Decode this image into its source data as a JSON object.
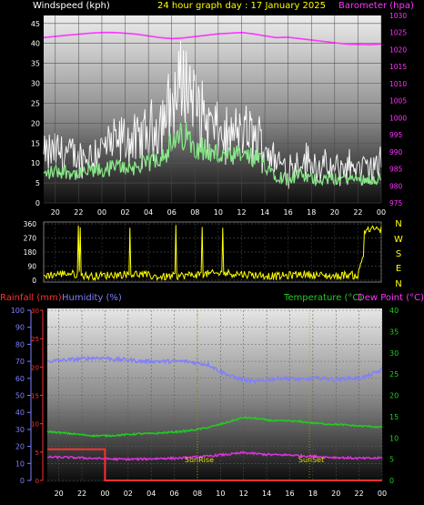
{
  "header": {
    "left_label": "Windspeed (kph)",
    "center_label": "24 hour graph day : 17 January 2025",
    "right_label": "Barometer (hpa)"
  },
  "colors": {
    "wind": "#ffffff",
    "gust": "#cccccc",
    "avg": "#88e888",
    "baro": "#ff33ff",
    "dir": "#ffff00",
    "rain": "#ff3030",
    "humidity": "#7f7fff",
    "temp": "#22cc22",
    "dew": "#dd33dd",
    "sun_marker": "#aaaa00"
  },
  "x_axis_ticks": [
    "20",
    "22",
    "00",
    "02",
    "04",
    "06",
    "08",
    "10",
    "12",
    "14",
    "16",
    "18",
    "20",
    "22",
    "00"
  ],
  "bottom_panel": {
    "rain_label": "Rainfall (mm)",
    "humidity_label": "Humidity (%)",
    "temp_label": "Temperature (°C)",
    "dew_label": "Dew Point (°C)",
    "sunrise_label": "SunRise",
    "sunset_label": "SunSet"
  },
  "direction_labels": [
    "N",
    "W",
    "S",
    "E",
    "N"
  ],
  "chart_data": [
    {
      "type": "line",
      "name": "wind-barometer",
      "title": "24 hour graph day : 17 January 2025",
      "x_range_hours": [
        -5,
        24
      ],
      "y_left": {
        "label": "Windspeed (kph)",
        "ticks": [
          0,
          5,
          10,
          15,
          20,
          25,
          30,
          35,
          40,
          45
        ],
        "ylim": [
          0,
          47
        ]
      },
      "y_right": {
        "label": "Barometer (hpa)",
        "ticks": [
          975,
          980,
          985,
          990,
          995,
          1000,
          1005,
          1010,
          1015,
          1020,
          1025,
          1030
        ],
        "ylim": [
          975,
          1030
        ]
      },
      "series": [
        {
          "name": "Barometer",
          "axis": "right",
          "x": [
            -5,
            -3,
            -1,
            0,
            1,
            2,
            3,
            4,
            5,
            6,
            7,
            8,
            9,
            10,
            11,
            12,
            13,
            14,
            15,
            16,
            17,
            18,
            19,
            20,
            21,
            22,
            23,
            24
          ],
          "y": [
            1023.5,
            1024.2,
            1024.8,
            1025.0,
            1025.0,
            1024.8,
            1024.5,
            1024.0,
            1023.5,
            1023.2,
            1023.4,
            1023.8,
            1024.2,
            1024.6,
            1024.8,
            1025.0,
            1024.6,
            1024.0,
            1023.5,
            1023.6,
            1023.2,
            1022.8,
            1022.4,
            1022.0,
            1021.6,
            1021.5,
            1021.4,
            1021.6
          ]
        },
        {
          "name": "Wind gust",
          "axis": "left",
          "x": [
            -5,
            -4,
            -3,
            -2,
            -1,
            0,
            1,
            2,
            3,
            4,
            5,
            6,
            6.5,
            7,
            7.5,
            8,
            9,
            10,
            11,
            12,
            13,
            14,
            15,
            16,
            17,
            18,
            19,
            20,
            21,
            22,
            23,
            24
          ],
          "y": [
            16,
            18,
            17,
            15,
            17,
            19,
            20,
            22,
            21,
            24,
            28,
            34,
            38,
            43,
            40,
            35,
            28,
            24,
            22,
            25,
            23,
            20,
            14,
            12,
            15,
            14,
            12,
            11,
            13,
            12,
            12,
            13
          ]
        },
        {
          "name": "Average wind",
          "axis": "left",
          "x": [
            -5,
            -4,
            -3,
            -2,
            -1,
            0,
            1,
            2,
            3,
            4,
            5,
            6,
            7,
            8,
            9,
            10,
            11,
            12,
            13,
            14,
            15,
            16,
            17,
            18,
            19,
            20,
            21,
            22,
            23,
            24
          ],
          "y": [
            7,
            8,
            8,
            7,
            8,
            8,
            9,
            9,
            9,
            10,
            12,
            14,
            17,
            15,
            13,
            12,
            11,
            12,
            11,
            10,
            7,
            6,
            7,
            6,
            6,
            6,
            6,
            6,
            6,
            6
          ]
        }
      ]
    },
    {
      "type": "scatter",
      "name": "wind-direction",
      "y_ticks": [
        360,
        270,
        180,
        90,
        0
      ],
      "ylim": [
        0,
        360
      ],
      "series": [
        {
          "name": "Direction",
          "x": [
            -5,
            -3,
            -1,
            1,
            3,
            5,
            7,
            9,
            11,
            13,
            14,
            15,
            16,
            17,
            18,
            19,
            20,
            21,
            22,
            23,
            24
          ],
          "y": [
            30,
            45,
            25,
            35,
            40,
            20,
            30,
            40,
            45,
            35,
            30,
            25,
            30,
            40,
            35,
            30,
            25,
            35,
            30,
            320,
            330
          ]
        }
      ]
    },
    {
      "type": "line",
      "name": "temperature-humidity-rain",
      "y_left_outer": {
        "label": "Humidity (%)",
        "ticks": [
          0,
          10,
          20,
          30,
          40,
          50,
          60,
          70,
          80,
          90,
          100
        ],
        "ylim": [
          0,
          100
        ]
      },
      "y_left_inner": {
        "label": "Rainfall (mm)",
        "ticks": [
          0,
          5,
          10,
          15,
          20,
          25,
          30
        ],
        "ylim": [
          0,
          30
        ]
      },
      "y_right": {
        "label": "Temperature (°C)",
        "ticks": [
          0,
          5,
          10,
          15,
          20,
          25,
          30,
          35,
          40
        ],
        "ylim": [
          0,
          40
        ]
      },
      "series": [
        {
          "name": "Humidity",
          "axis": "left_outer",
          "x": [
            -5,
            -3,
            -1,
            0,
            1,
            2,
            3,
            4,
            5,
            6,
            7,
            8,
            9,
            10,
            11,
            12,
            13,
            14,
            15,
            16,
            17,
            18,
            19,
            20,
            21,
            22,
            23,
            24
          ],
          "y": [
            70,
            71,
            72,
            72,
            71,
            71,
            70,
            70,
            70,
            70,
            70,
            69,
            68,
            64,
            61,
            59,
            58,
            59,
            60,
            60,
            59,
            60,
            60,
            59,
            60,
            60,
            62,
            65
          ]
        },
        {
          "name": "Temperature",
          "axis": "right",
          "x": [
            -5,
            -3,
            -1,
            0,
            1,
            2,
            3,
            4,
            5,
            6,
            7,
            8,
            9,
            10,
            11,
            12,
            13,
            14,
            15,
            16,
            17,
            18,
            19,
            20,
            21,
            22,
            23,
            24
          ],
          "y": [
            11.5,
            11.0,
            10.5,
            10.5,
            10.6,
            10.8,
            11.0,
            11.0,
            11.2,
            11.4,
            11.6,
            12.0,
            12.5,
            13.2,
            14.0,
            14.8,
            14.6,
            14.2,
            14.0,
            14.0,
            13.8,
            13.5,
            13.3,
            13.2,
            13.0,
            12.8,
            12.7,
            12.5
          ]
        },
        {
          "name": "Dew point",
          "axis": "right",
          "x": [
            -5,
            -3,
            -1,
            0,
            1,
            2,
            3,
            4,
            5,
            6,
            7,
            8,
            9,
            10,
            11,
            12,
            13,
            14,
            15,
            16,
            17,
            18,
            19,
            20,
            21,
            22,
            23,
            24
          ],
          "y": [
            5.5,
            5.4,
            5.2,
            5.1,
            5.0,
            5.0,
            5.0,
            5.1,
            5.2,
            5.2,
            5.3,
            5.5,
            5.7,
            6.0,
            6.2,
            6.5,
            6.3,
            6.1,
            6.0,
            6.0,
            5.8,
            5.7,
            5.5,
            5.4,
            5.3,
            5.2,
            5.2,
            5.3
          ]
        },
        {
          "name": "Rainfall",
          "axis": "left_inner",
          "x": [
            -5,
            0,
            0,
            24
          ],
          "y": [
            5.5,
            5.5,
            0,
            0
          ]
        }
      ],
      "sunrise_hour": 8,
      "sunset_hour": 17.7
    }
  ]
}
